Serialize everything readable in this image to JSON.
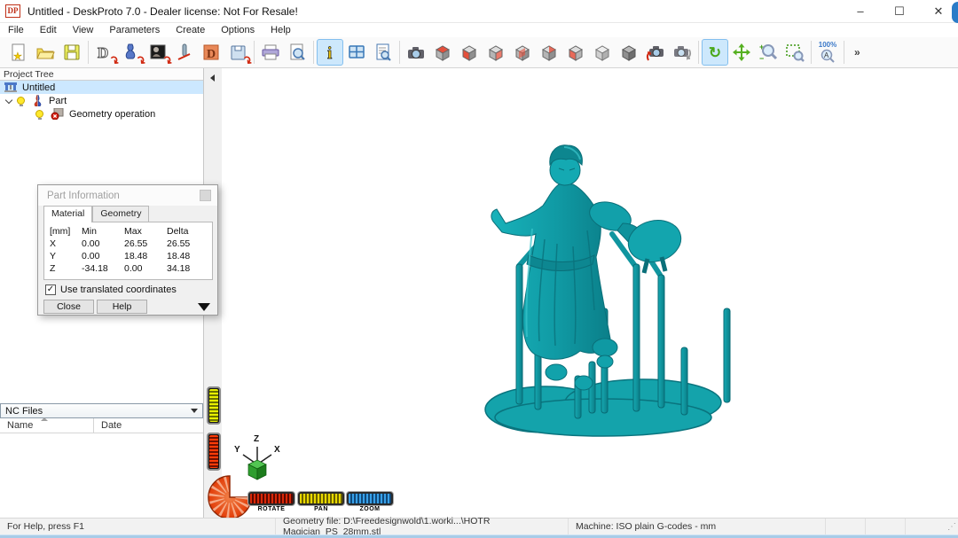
{
  "window": {
    "title": "Untitled - DeskProto 7.0 - Dealer license: Not For Resale!",
    "logo_text": "DP",
    "controls": {
      "minimize": "–",
      "maximize": "☐",
      "close": "✕"
    }
  },
  "menu": {
    "items": [
      "File",
      "Edit",
      "View",
      "Parameters",
      "Create",
      "Options",
      "Help"
    ]
  },
  "toolbar": {
    "zoom_level_label": "100%",
    "overflow_label": "»",
    "selected_buttons": [
      "info-button",
      "rotate-mode-button"
    ],
    "icons": {
      "new-file-icon": "page-with-star",
      "open-icon": "yellow-folder",
      "save-icon": "floppy-disk",
      "wizard-geometry-icon": "D-with-red-arrow",
      "wizard-part-icon": "part-with-red-arrow",
      "wizard-bitmap-icon": "bitmap-with-red-arrow",
      "wizard-cutter-icon": "cutter-with-red-line",
      "wizard-deskproto-icon": "orange-D-box",
      "wizard-ncfile-icon": "floppy-with-red-arrow",
      "print-icon": "printer",
      "print-preview-icon": "page-with-magnifier",
      "info-icon": "yellow-i",
      "window-layout-icon": "blue-window-grid",
      "report-icon": "page-with-magnifier-lines",
      "snapshot-icon": "camera",
      "view-cube-icons": "gray-cubes-with-red-faces",
      "rotate-camera-icon": "camera-red-arrow",
      "pan-camera-icon": "camera-gray-arrow",
      "rotate-mode-icon": "green-rotate-arrows",
      "pan-mode-icon": "green-four-way-arrow",
      "zoom-mode-icon": "magnifier-plus-minus",
      "zoom-window-icon": "dashed-rect-magnifier",
      "zoom-100-icon": "magnifier-A"
    }
  },
  "project_tree": {
    "header": "Project Tree",
    "items": [
      {
        "label": "Untitled",
        "selected": true
      },
      {
        "label": "Part",
        "selected": false
      },
      {
        "label": "Geometry operation",
        "selected": false
      }
    ]
  },
  "part_info_dialog": {
    "title": "Part Information",
    "tabs": [
      "Material",
      "Geometry"
    ],
    "table": {
      "headers": [
        "[mm]",
        "Min",
        "Max",
        "Delta"
      ],
      "rows": [
        [
          "X",
          "0.00",
          "26.55",
          "26.55"
        ],
        [
          "Y",
          "0.00",
          "18.48",
          "18.48"
        ],
        [
          "Z",
          "-34.18",
          "0.00",
          "34.18"
        ]
      ]
    },
    "checkbox_label": "Use translated coordinates",
    "checkbox_checked": true,
    "checkmark": "✓",
    "buttons": {
      "close": "Close",
      "help": "Help"
    }
  },
  "nc_files": {
    "header": "NC Files",
    "columns": [
      "Name",
      "Date"
    ]
  },
  "viewport": {
    "model_name": "magician figure with print supports",
    "model_color": "#12a2ab",
    "model_shadow_color": "#0a737d",
    "axis": {
      "x": "X",
      "y": "Y",
      "z": "Z"
    },
    "gauges": {
      "rotate": "ROTATE",
      "pan": "PAN",
      "zoom": "ZOOM"
    }
  },
  "status_bar": {
    "help": "For Help, press F1",
    "geometry_file": "Geometry file: D:\\Freedesignwold\\1.worki...\\HOTR Magician_PS_28mm.stl",
    "machine": "Machine: ISO plain G-codes - mm",
    "grip": "⋰"
  }
}
